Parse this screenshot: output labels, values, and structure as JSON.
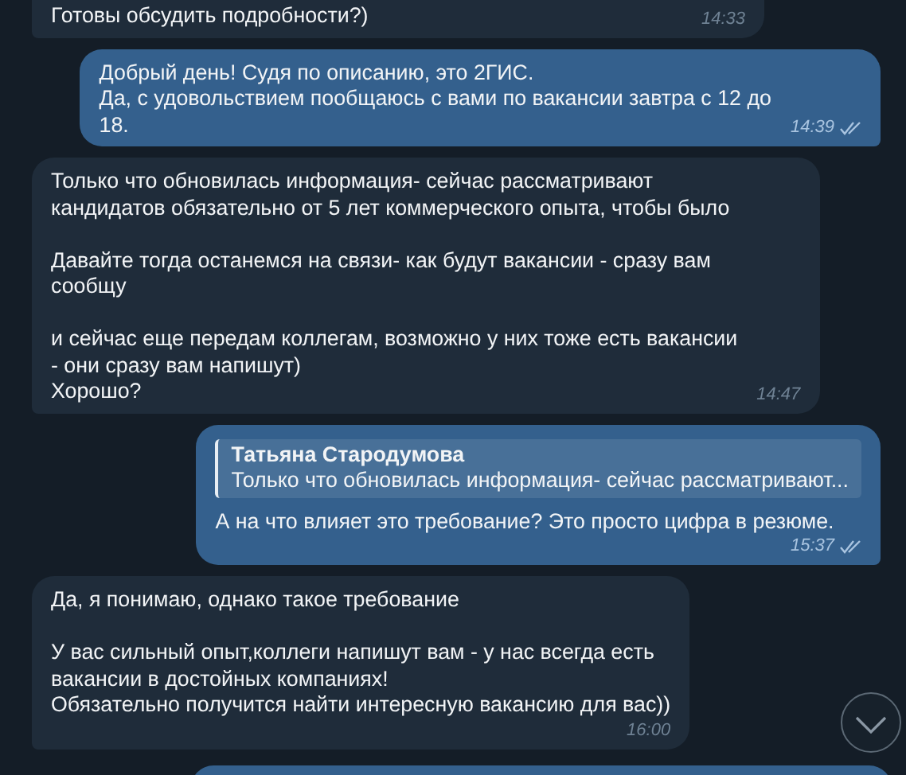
{
  "messages": [
    {
      "kind": "in",
      "cut_off": true,
      "text": "Готовы обсудить подробности?)",
      "time": "14:33"
    },
    {
      "kind": "out",
      "cut_off": false,
      "text": "Добрый день! Судя по описанию, это 2ГИС.\nДа, с удовольствием пообщаюсь с вами по вакансии завтра с 12 до\n18.",
      "time": "14:39",
      "read": true
    },
    {
      "kind": "in",
      "cut_off": false,
      "text": "Только что обновилась информация- сейчас рассматривают\nкандидатов обязательно от 5 лет коммерческого опыта, чтобы было\n\nДавайте тогда останемся на связи- как будут вакансии - сразу вам\nсообщу\n\nи сейчас еще передам коллегам, возможно у них тоже есть вакансии\n- они сразу вам напишут)\nХорошо?",
      "time": "14:47"
    },
    {
      "kind": "out",
      "cut_off": false,
      "reply": {
        "author": "Татьяна Стародумова",
        "snippet": "Только что обновилась информация- сейчас рассматривают..."
      },
      "text": "А на что влияет это требование? Это просто цифра в резюме.",
      "time": "15:37",
      "read": true
    },
    {
      "kind": "in",
      "cut_off": false,
      "text": "Да, я понимаю, однако такое требование\n\nУ вас сильный опыт,коллеги напишут вам - у нас всегда есть\nвакансии в достойных компаниях!\nОбязательно получится найти интересную вакансию для вас))",
      "time": "16:00"
    }
  ]
}
